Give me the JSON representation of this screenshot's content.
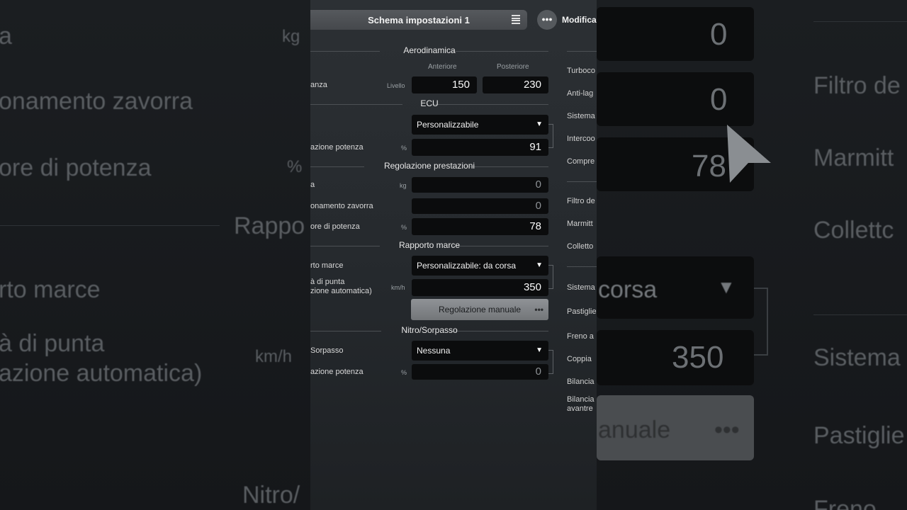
{
  "header": {
    "title": "Schema impostazioni 1",
    "modify_label": "Modifica",
    "more_glyph": "•••"
  },
  "aero": {
    "section": "Aerodinamica",
    "col_front": "Anteriore",
    "col_rear": "Posteriore",
    "row_label": "anza",
    "unit": "Livello",
    "front_value": "150",
    "rear_value": "230"
  },
  "ecu": {
    "section": "ECU",
    "select_value": "Personalizzabile",
    "power_label": "azione potenza",
    "power_unit": "%",
    "power_value": "91"
  },
  "perf": {
    "section": "Regolazione prestazioni",
    "row1_label": "a",
    "row1_unit": "kg",
    "row1_value": "0",
    "row2_label": "onamento zavorra",
    "row2_value": "0",
    "row3_label": "ore di potenza",
    "row3_unit": "%",
    "row3_value": "78"
  },
  "gear": {
    "section": "Rapporto marce",
    "row1_label": "rto marce",
    "select_value": "Personalizzabile: da corsa",
    "row2_label_1": "à di punta",
    "row2_label_2": "zione automatica)",
    "row2_unit": "km/h",
    "row2_value": "350",
    "manual_button": "Regolazione manuale",
    "manual_dots": "•••"
  },
  "nitro": {
    "section": "Nitro/Sorpasso",
    "row1_label": "Sorpasso",
    "select_value": "Nessuna",
    "row2_label": "azione potenza",
    "row2_unit": "%",
    "row2_value": "0"
  },
  "right_column": {
    "items": [
      "Turboco",
      "Anti-lag",
      "Sistema",
      "Intercoo",
      "Compre",
      "Filtro de",
      "Marmitt",
      "Colletto",
      "Sistema",
      "Pastiglie",
      "Freno a",
      "Coppia",
      "Bilancia",
      "Bilancia",
      "avantre"
    ]
  },
  "ghost_left": {
    "t1": "a",
    "t2": "onamento zavorra",
    "t3": "ore di potenza",
    "t4": "%",
    "t5": "Rappo",
    "t6": "rto marce",
    "t7": "à di punta",
    "t8": "azione automatica)",
    "t9": "km/h",
    "t10": "kg",
    "t11": "Nitro/"
  },
  "ghost_right": {
    "n1": "0",
    "n2": "0",
    "n3": "78",
    "t1": "Filtro de",
    "t2": "Marmitt",
    "t3": "Collettc",
    "t4": "corsa",
    "t5": "350",
    "t6": "Sistema",
    "t7": "anuale",
    "t8": "Pastiglie",
    "t9": "Freno"
  },
  "colors": {
    "panel_bg": "#2a2e32",
    "field_bg": "#0b0c0d",
    "button_bg": "#85888c"
  }
}
